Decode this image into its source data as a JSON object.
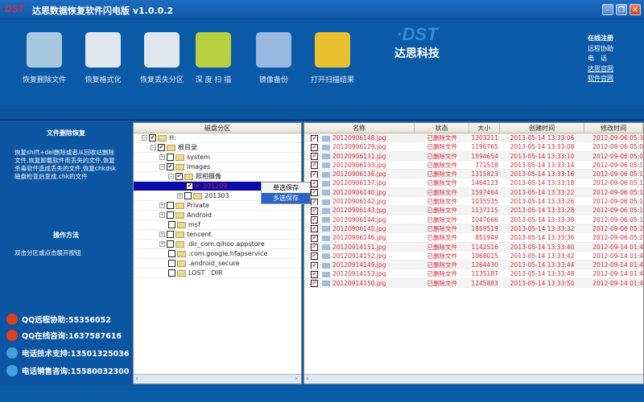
{
  "window": {
    "title": "达思数据恢复软件闪电版 v1.0.0.2",
    "logo": "DST"
  },
  "toolbar": [
    {
      "label": "恢复删除文件",
      "icon": "recycle-bin-icon",
      "color": "#a8c8e0"
    },
    {
      "label": "恢复格式化",
      "icon": "format-disk-icon",
      "color": "#dfe6ee"
    },
    {
      "label": "恢复丢失分区",
      "icon": "partition-disk-icon",
      "color": "#dfe6ee"
    },
    {
      "label": "深 度 扫 描",
      "icon": "deep-scan-folder-icon",
      "color": "#b8d040"
    },
    {
      "label": "镜像备份",
      "icon": "image-backup-icon",
      "color": "#9ab8e0"
    },
    {
      "label": "打开扫描结果",
      "icon": "open-scan-result-icon",
      "color": "#e8c030"
    }
  ],
  "brand": {
    "logo": "DST",
    "name": "达思科技"
  },
  "links": {
    "register": "在线注册",
    "remote": "远程协助",
    "phone": "电　话",
    "site1": "达思官网",
    "site2": "软件官网"
  },
  "left": {
    "title": "文件删除恢复",
    "desc": "恢复shift+del删除或者从回收站删除文件,恢复卸载软件而丢失的文件,恢复杀毒软件造成丢失的文件,恢复chkdsk磁盘检查后变成.chk的文件",
    "howto_title": "操作方法",
    "howto": "双击分区或点击展开按钮",
    "contacts": [
      "QQ远程协助:55356052",
      "QQ在线咨询:1637587616",
      "电话技术支持:13501325036",
      "电话销售咨询:15580032300"
    ]
  },
  "tree": {
    "header": "磁盘分区",
    "items": [
      {
        "label": "H:",
        "depth": 0,
        "exp": "−",
        "checked": true
      },
      {
        "label": "根目录",
        "depth": 1,
        "exp": "−",
        "checked": true
      },
      {
        "label": "system",
        "depth": 2,
        "exp": "+",
        "checked": false
      },
      {
        "label": "Images",
        "depth": 2,
        "exp": "−",
        "checked": true
      },
      {
        "label": "照相摄像",
        "depth": 3,
        "exp": "−",
        "checked": true
      },
      {
        "label": "201209",
        "depth": 4,
        "exp": "",
        "checked": true,
        "selected": true
      },
      {
        "label": "201303",
        "depth": 4,
        "exp": "+",
        "checked": false
      },
      {
        "label": "Private",
        "depth": 2,
        "exp": "+",
        "checked": false
      },
      {
        "label": "Android",
        "depth": 2,
        "exp": "+",
        "checked": false
      },
      {
        "label": "msf",
        "depth": 2,
        "exp": "",
        "checked": false
      },
      {
        "label": "tencent",
        "depth": 2,
        "exp": "+",
        "checked": false
      },
      {
        "label": ".dir_com.qihoo.appstore",
        "depth": 2,
        "exp": "+",
        "checked": false
      },
      {
        "label": ".com.google.hfapservice",
        "depth": 2,
        "exp": "",
        "checked": false
      },
      {
        "label": ".android_secure",
        "depth": 2,
        "exp": "",
        "checked": false
      },
      {
        "label": "LOST　DIR",
        "depth": 2,
        "exp": "",
        "checked": false
      }
    ]
  },
  "context_menu": {
    "single": "单选保存",
    "multi": "多选保存"
  },
  "list": {
    "columns": [
      "名称",
      "状态",
      "大小",
      "创建时间",
      "修改时间"
    ],
    "rows": [
      [
        "20120906148.jpg",
        "已删除文件",
        "1203211",
        "2013-05-14 13:33:06",
        "2012-09-06 05:3"
      ],
      [
        "20120906129.jpg",
        "已删除文件",
        "1196765",
        "2013-05-14 13:33:08",
        "2012-09-06 05:0"
      ],
      [
        "20120906131.jpg",
        "已删除文件",
        "1594654",
        "2013-05-14 13:33:10",
        "2012-09-06 05:0"
      ],
      [
        "20120906133.jpg",
        "已删除文件",
        "771518",
        "2013-05-14 13:33:14",
        "2012-09-06 05:1"
      ],
      [
        "20120906136.jpg",
        "已删除文件",
        "1315823",
        "2013-05-14 13:33:16",
        "2012-09-06 05:1"
      ],
      [
        "20120906137.jpg",
        "已删除文件",
        "1464123",
        "2013-05-14 13:33:18",
        "2012-09-06 05:1"
      ],
      [
        "20120906140.jpg",
        "已删除文件",
        "1597464",
        "2013-05-14 13:33:22",
        "2012-09-06 05:1"
      ],
      [
        "20120906142.jpg",
        "已删除文件",
        "1035535",
        "2013-05-14 13:33:26",
        "2012-09-06 05:1"
      ],
      [
        "20120906143.jpg",
        "已删除文件",
        "1137115",
        "2013-05-14 13:33:28",
        "2012-09-06 05:1"
      ],
      [
        "20120906144.jpg",
        "已删除文件",
        "1047666",
        "2013-05-14 13:33:30",
        "2012-09-06 05:1"
      ],
      [
        "20120906145.jpg",
        "已删除文件",
        "1859519",
        "2013-05-14 13:33:32",
        "2012-09-06 05:2"
      ],
      [
        "20120906146.jpg",
        "已删除文件",
        "851949",
        "2013-05-14 13:33:36",
        "2012-09-06 05:2"
      ],
      [
        "20120914151.jpg",
        "已删除文件",
        "1142516",
        "2013-05-14 13:33:40",
        "2012-09-14 01:4"
      ],
      [
        "20120914152.jpg",
        "已删除文件",
        "1068015",
        "2013-05-14 13:33:42",
        "2012-09-14 01:4"
      ],
      [
        "20120914149.jpg",
        "已删除文件",
        "1264430",
        "2013-05-14 13:33:44",
        "2012-09-14 01:4"
      ],
      [
        "20120914153.jpg",
        "已删除文件",
        "1135187",
        "2013-05-14 13:33:48",
        "2012-09-14 01:4"
      ],
      [
        "20120914150.jpg",
        "已删除文件",
        "1245883",
        "2013-05-14 13:33:50",
        "2012-09-14 01:4"
      ]
    ]
  }
}
